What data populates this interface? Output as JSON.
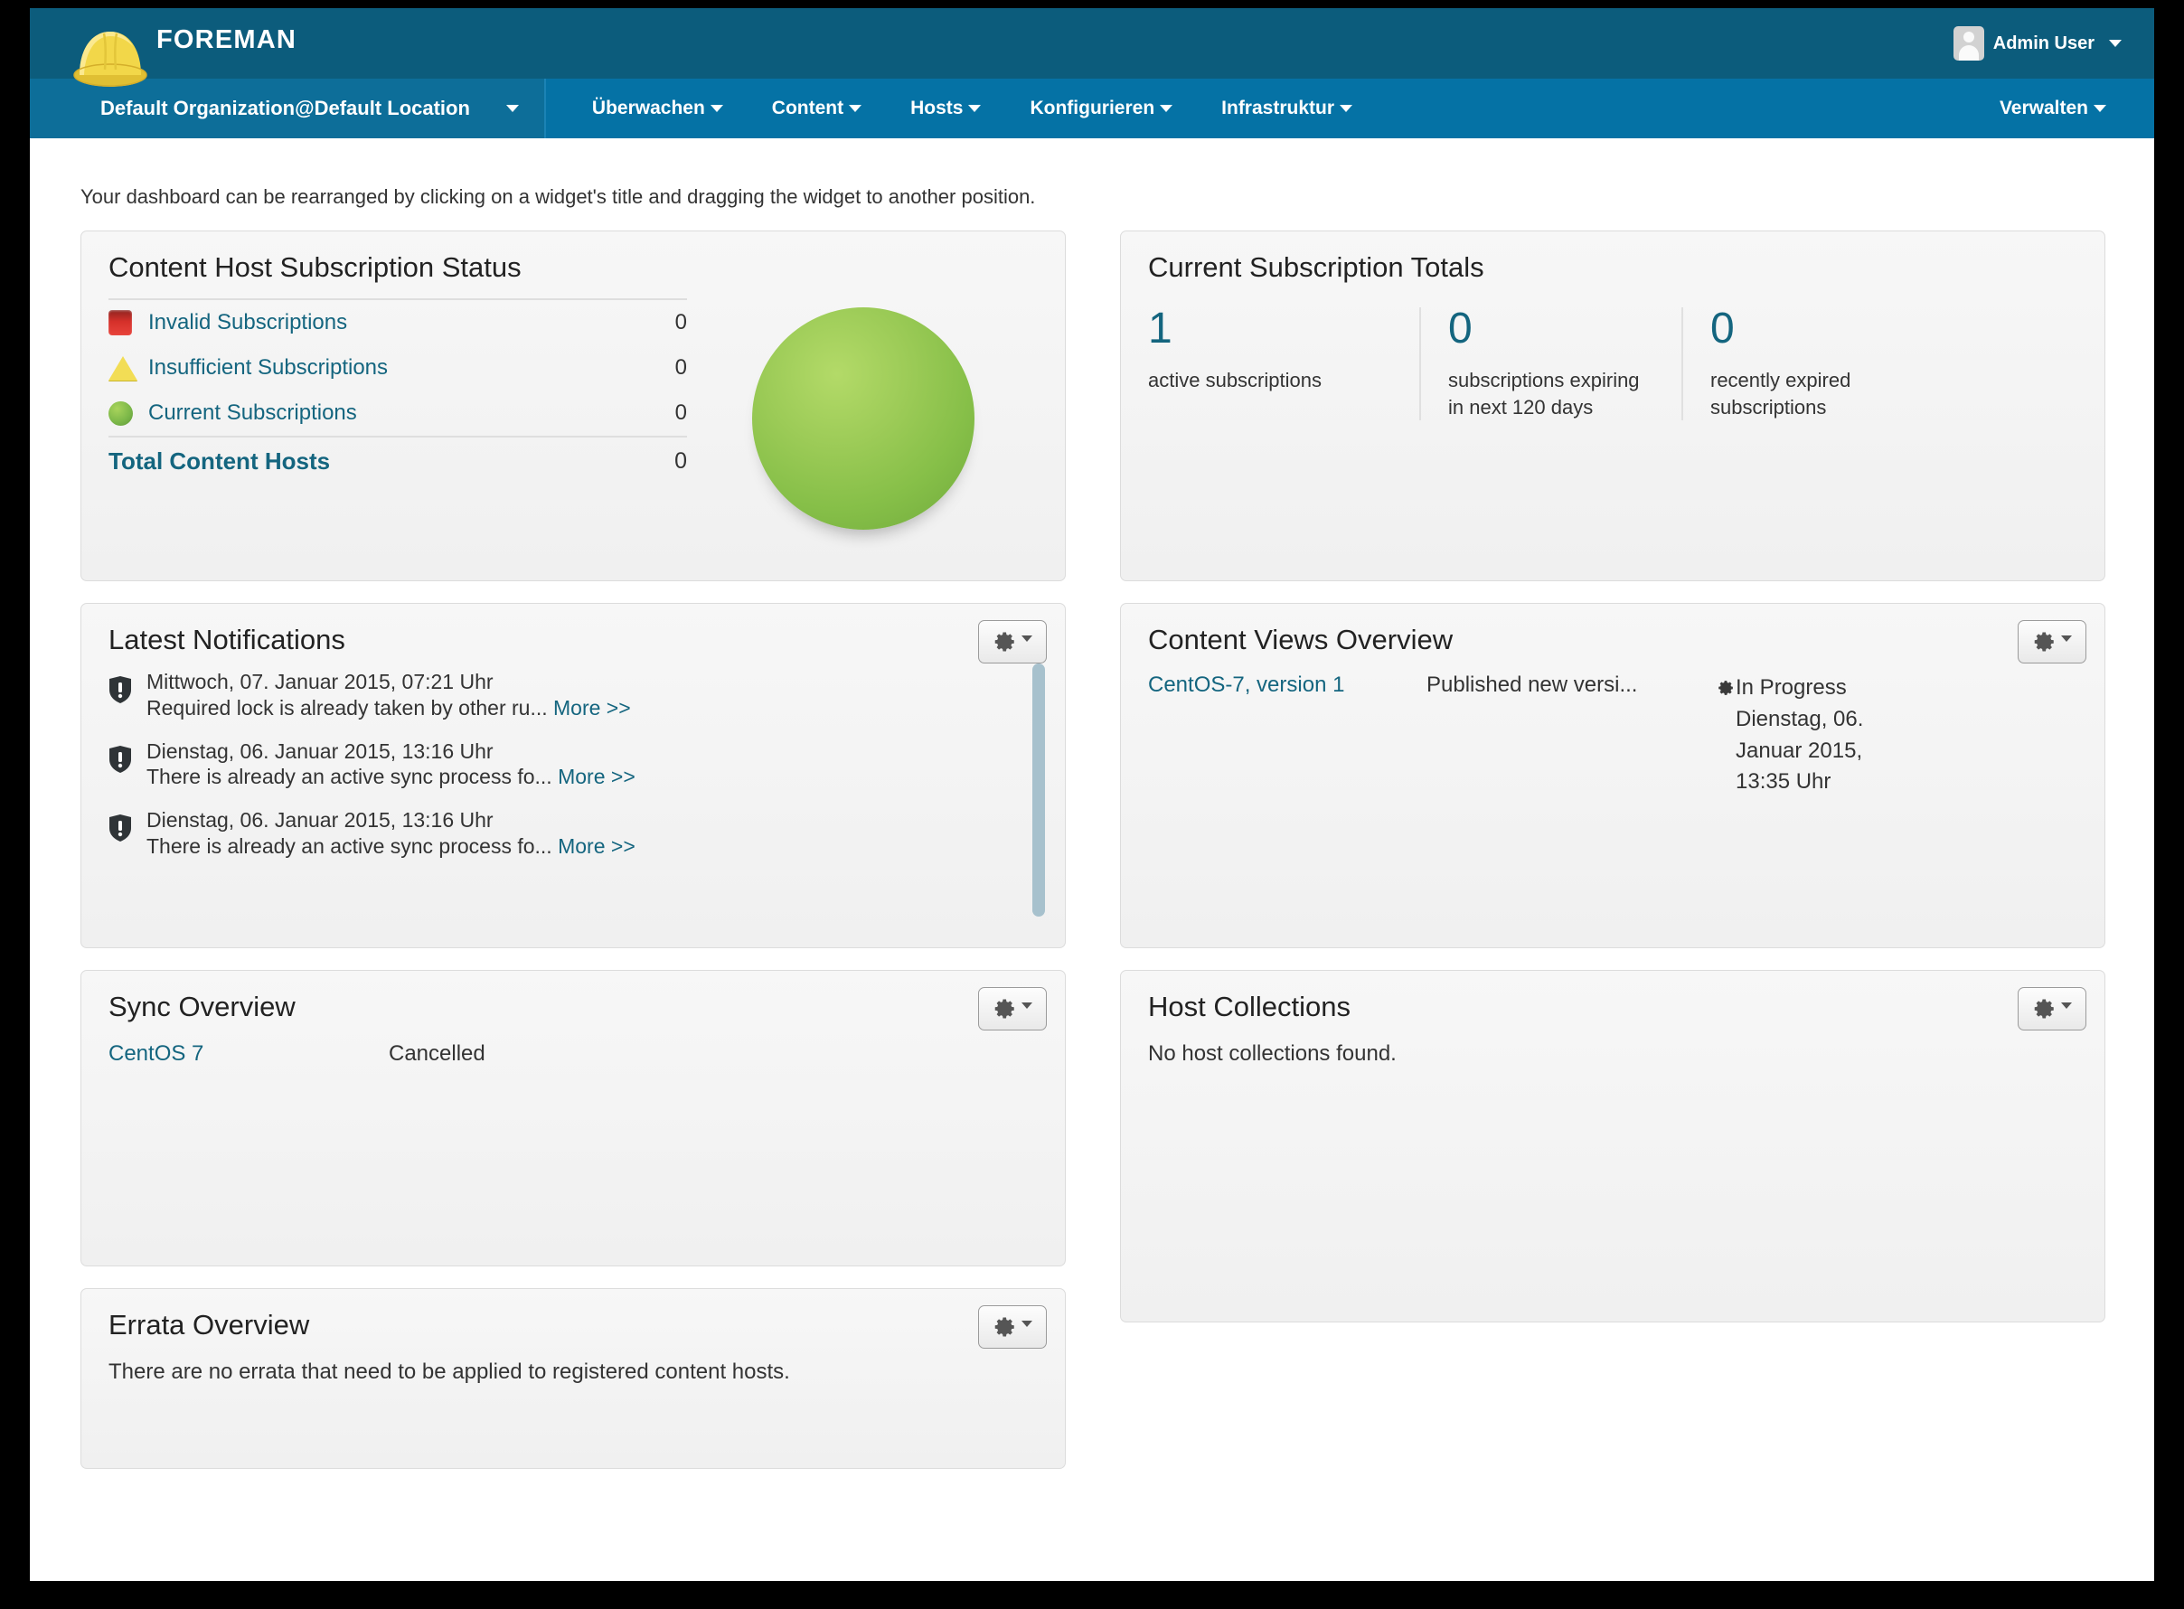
{
  "header": {
    "brand": "FOREMAN",
    "logo_icon": "hardhat-icon",
    "user": "Admin User",
    "avatar_icon": "user-avatar-icon",
    "org_location": "Default Organization@Default Location",
    "nav": [
      {
        "label": "Überwachen"
      },
      {
        "label": "Content"
      },
      {
        "label": "Hosts"
      },
      {
        "label": "Konfigurieren"
      },
      {
        "label": "Infrastruktur"
      }
    ],
    "nav_right": {
      "label": "Verwalten"
    }
  },
  "page": {
    "hint": "Your dashboard can be rearranged by clicking on a widget's title and dragging the widget to another position."
  },
  "widgets": {
    "subscription_status": {
      "title": "Content Host Subscription Status",
      "rows": [
        {
          "icon": "red-square-icon",
          "label": "Invalid Subscriptions",
          "value": "0"
        },
        {
          "icon": "yellow-triangle-icon",
          "label": "Insufficient Subscriptions",
          "value": "0"
        },
        {
          "icon": "green-circle-icon",
          "label": "Current Subscriptions",
          "value": "0"
        }
      ],
      "total_label": "Total Content Hosts",
      "total_value": "0"
    },
    "subscription_totals": {
      "title": "Current Subscription Totals",
      "cells": [
        {
          "number": "1",
          "caption": "active subscriptions"
        },
        {
          "number": "0",
          "caption": "subscriptions expiring in next 120 days"
        },
        {
          "number": "0",
          "caption": "recently expired subscriptions"
        }
      ]
    },
    "latest_notifications": {
      "title": "Latest Notifications",
      "gear_icon": "gear-icon",
      "items": [
        {
          "icon": "shield-alert-icon",
          "date": "Mittwoch, 07. Januar 2015, 07:21 Uhr",
          "text": "Required lock is already taken by other ru...",
          "more": "More >>"
        },
        {
          "icon": "shield-alert-icon",
          "date": "Dienstag, 06. Januar 2015, 13:16 Uhr",
          "text": "There is already an active sync process fo...",
          "more": "More >>"
        },
        {
          "icon": "shield-alert-icon",
          "date": "Dienstag, 06. Januar 2015, 13:16 Uhr",
          "text": "There is already an active sync process fo...",
          "more": "More >>"
        }
      ]
    },
    "content_views": {
      "title": "Content Views Overview",
      "gear_icon": "gear-icon",
      "name": "CentOS-7, version 1",
      "description": "Published new versi...",
      "status_icon": "cog-icon",
      "status": "In Progress Dienstag, 06. Januar 2015, 13:35 Uhr"
    },
    "sync_overview": {
      "title": "Sync Overview",
      "gear_icon": "gear-icon",
      "name": "CentOS 7",
      "state": "Cancelled"
    },
    "host_collections": {
      "title": "Host Collections",
      "gear_icon": "gear-icon",
      "empty": "No host collections found."
    },
    "errata_overview": {
      "title": "Errata Overview",
      "gear_icon": "gear-icon",
      "empty": "There are no errata that need to be applied to registered content hosts."
    }
  },
  "colors": {
    "topbar": "#0c5c7c",
    "navbar": "#0572a5",
    "link": "#14657f",
    "status_invalid": "#d5302a",
    "status_insufficient": "#f2dd55",
    "status_current": "#86bf48",
    "scrollbar": "#a7c1cd"
  }
}
